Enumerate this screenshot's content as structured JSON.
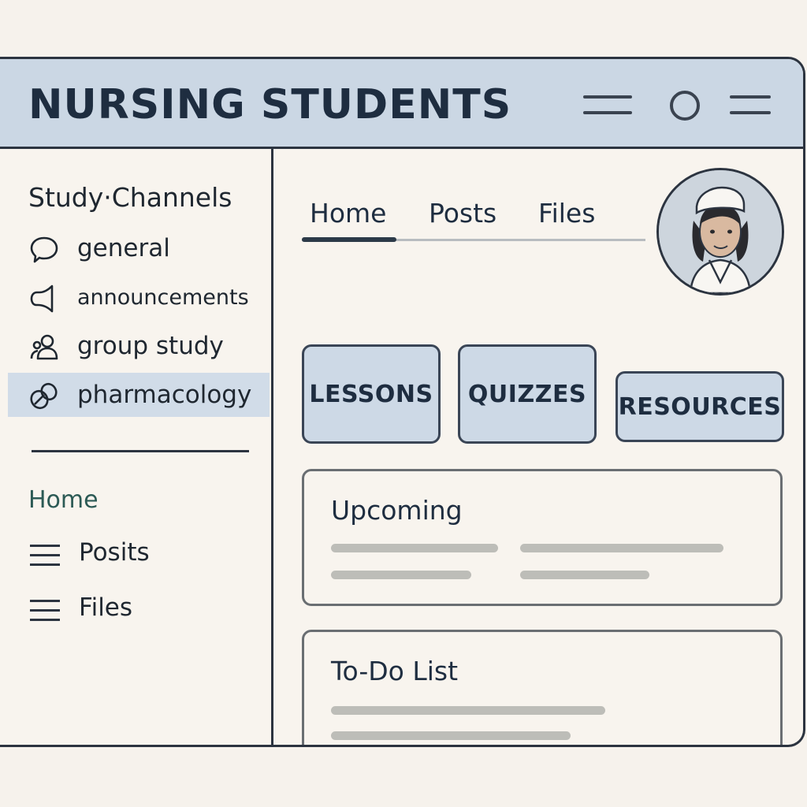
{
  "header": {
    "title": "NURSING STUDENTS",
    "icons": [
      "menu-icon",
      "circle-icon",
      "menu-icon"
    ]
  },
  "sidebar": {
    "section_title": "Study·Channels",
    "channels": [
      {
        "label": "general",
        "icon": "chat-bubble-icon",
        "selected": false
      },
      {
        "label": "announcements",
        "icon": "megaphone-icon",
        "selected": false
      },
      {
        "label": "group study",
        "icon": "people-icon",
        "selected": false
      },
      {
        "label": "pharmacology",
        "icon": "pills-icon",
        "selected": true
      }
    ],
    "links": {
      "home": "Home",
      "posts": "Posits",
      "files": "Files"
    }
  },
  "main": {
    "tabs": [
      {
        "label": "Home",
        "active": true
      },
      {
        "label": "Posts",
        "active": false
      },
      {
        "label": "Files",
        "active": false
      }
    ],
    "buttons": {
      "lessons": "LESSONS",
      "quizzes": "QUIZZES",
      "resources": "RESOURCES"
    },
    "cards": {
      "upcoming": "Upcoming",
      "todo": "To-Do List"
    }
  },
  "colors": {
    "header_bg": "#cbd7e4",
    "selected_bg": "#d1dce8",
    "button_bg": "#cdd9e6",
    "border": "#2c3440"
  }
}
